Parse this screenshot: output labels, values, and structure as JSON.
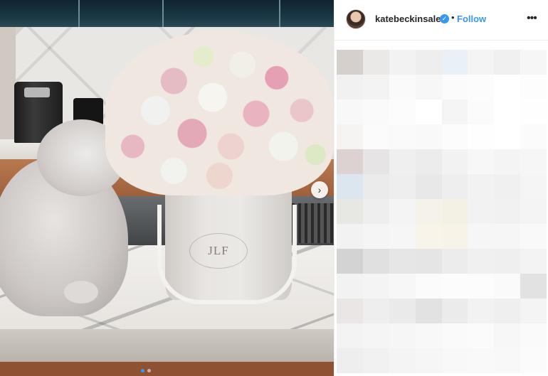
{
  "media": {
    "box_logo_text": "JLF",
    "next_arrow": "›",
    "carousel": {
      "count": 2,
      "active_index": 0
    }
  },
  "header": {
    "username": "katebeckinsale",
    "verified_mark": "✓",
    "separator": "•",
    "follow_label": "Follow",
    "more_glyph": "•••"
  },
  "colors": {
    "accent": "#3897f0",
    "username": "#262626",
    "border": "#efefef"
  },
  "icons": {
    "verified": "verified-badge-icon",
    "more": "more-options-icon",
    "next": "chevron-right-icon"
  }
}
